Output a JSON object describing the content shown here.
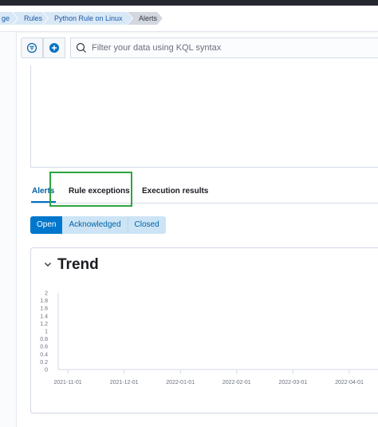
{
  "breadcrumbs": [
    {
      "label": "ge"
    },
    {
      "label": "Rules"
    },
    {
      "label": "Python Rule on Linux"
    },
    {
      "label": "Alerts"
    }
  ],
  "search": {
    "placeholder": "Filter your data using KQL syntax"
  },
  "icons": {
    "filter": "filter-icon",
    "add": "add-filter-icon",
    "search": "search-icon",
    "chevron": "chevron-down-icon"
  },
  "tabs": [
    {
      "label": "Alerts",
      "active": true
    },
    {
      "label": "Rule exceptions",
      "active": false
    },
    {
      "label": "Execution results",
      "active": false
    }
  ],
  "status_filters": [
    {
      "label": "Open",
      "selected": true
    },
    {
      "label": "Acknowledged",
      "selected": false
    },
    {
      "label": "Closed",
      "selected": false
    }
  ],
  "trend": {
    "title": "Trend"
  },
  "colors": {
    "accent": "#0077cc",
    "highlight": "#2ca540"
  },
  "chart_data": {
    "type": "bar",
    "x": [
      "2021-11-01",
      "2021-12-01",
      "2022-01-01",
      "2022-02-01",
      "2022-03-01",
      "2022-04-01"
    ],
    "values": [],
    "yticks": [
      "2",
      "1.8",
      "1.6",
      "1.4",
      "1.2",
      "1",
      "0.8",
      "0.6",
      "0.4",
      "0.2",
      "0"
    ],
    "ylim": [
      0,
      2
    ],
    "grid": false
  }
}
